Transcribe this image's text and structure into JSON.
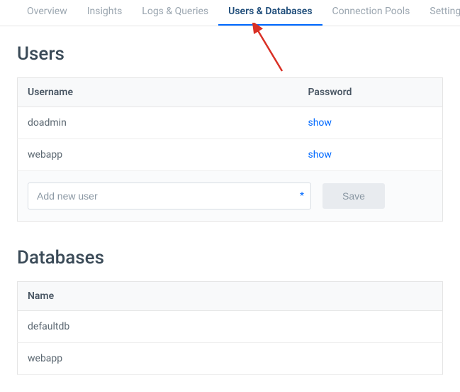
{
  "tabs": {
    "overview": "Overview",
    "insights": "Insights",
    "logs": "Logs & Queries",
    "users_dbs": "Users & Databases",
    "pools": "Connection Pools",
    "settings": "Settings"
  },
  "users": {
    "title": "Users",
    "columns": {
      "username": "Username",
      "password": "Password"
    },
    "rows": [
      {
        "username": "doadmin",
        "password_action": "show"
      },
      {
        "username": "webapp",
        "password_action": "show"
      }
    ],
    "add_placeholder": "Add new user",
    "required_marker": "*",
    "save_label": "Save"
  },
  "databases": {
    "title": "Databases",
    "columns": {
      "name": "Name"
    },
    "rows": [
      {
        "name": "defaultdb"
      },
      {
        "name": "webapp"
      }
    ]
  },
  "annotation": {
    "arrow_color": "#d93025"
  }
}
